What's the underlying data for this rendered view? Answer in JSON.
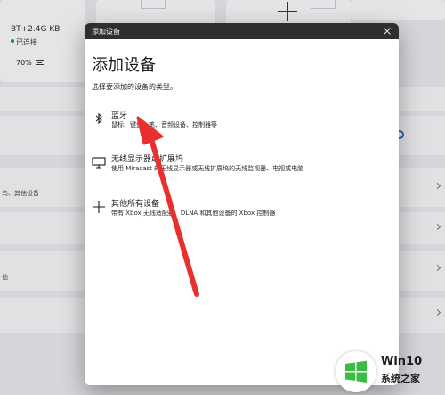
{
  "background": {
    "device_card": {
      "name": "BT+2.4G KB",
      "status": "已连接",
      "battery": "70%"
    },
    "left_rows": [
      {
        "text": ""
      },
      {
        "text": ""
      },
      {
        "text": "鸟、其他设备"
      },
      {
        "text": ""
      },
      {
        "text": "他"
      },
      {
        "text": ""
      }
    ]
  },
  "dialog": {
    "titlebar": "添加设备",
    "heading": "添加设备",
    "subtitle": "选择要添加的设备的类型。",
    "options": [
      {
        "icon": "bluetooth-icon",
        "title": "蓝牙",
        "desc": "鼠标、键盘、笔、音频设备、控制器等"
      },
      {
        "icon": "monitor-icon",
        "title": "无线显示器或扩展坞",
        "desc": "使用 Miracast 的无线显示器或无线扩展坞的无线监视器、电视或电脑"
      },
      {
        "icon": "plus-icon",
        "title": "其他所有设备",
        "desc": "带有 Xbox 无线适配器、DLNA 和其他设备的 Xbox 控制器"
      }
    ]
  },
  "watermark": {
    "line1": "Win10",
    "line2": "系统之家"
  },
  "colors": {
    "titlebar": "#2f2f2f",
    "arrow": "#e8302f",
    "connected_dot": "#1a8c3a"
  }
}
